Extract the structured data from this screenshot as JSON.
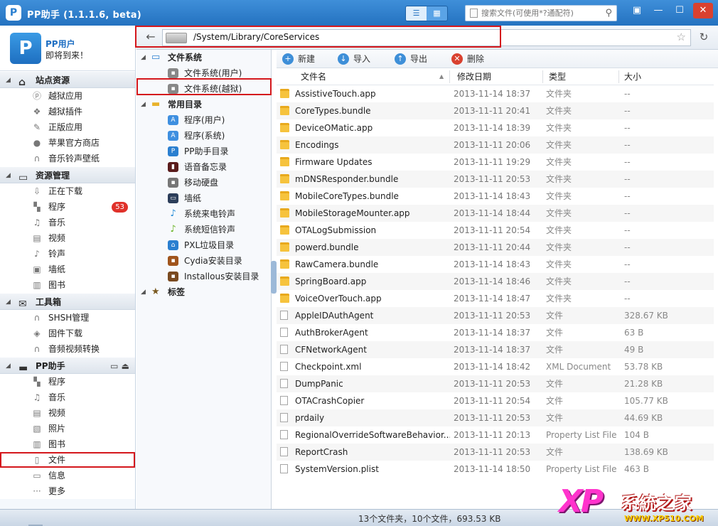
{
  "app": {
    "logo": "P",
    "title": "PP助手 (1.1.1.6, beta)"
  },
  "search": {
    "placeholder": "搜索文件(可使用*?通配符)"
  },
  "window_controls": {
    "menu": "▣",
    "minimize": "—",
    "maximize": "☐",
    "close": "✕"
  },
  "user": {
    "name": "PP用户",
    "status": "即将到来！"
  },
  "sections": {
    "site": {
      "title": "站点资源",
      "items": [
        {
          "label": "越狱应用",
          "icon": "p-circle-icon"
        },
        {
          "label": "越狱插件",
          "icon": "plugin-icon"
        },
        {
          "label": "正版应用",
          "icon": "app-store-icon"
        },
        {
          "label": "苹果官方商店",
          "icon": "apple-icon"
        },
        {
          "label": "音乐铃声壁纸",
          "icon": "headphones-icon"
        }
      ]
    },
    "resources": {
      "title": "资源管理",
      "items": [
        {
          "label": "正在下载",
          "icon": "download-icon"
        },
        {
          "label": "程序",
          "icon": "apps-grid-icon",
          "badge": "53"
        },
        {
          "label": "音乐",
          "icon": "music-icon"
        },
        {
          "label": "视频",
          "icon": "video-icon"
        },
        {
          "label": "铃声",
          "icon": "ringtone-icon"
        },
        {
          "label": "墙纸",
          "icon": "wallpaper-icon"
        },
        {
          "label": "图书",
          "icon": "book-icon"
        }
      ]
    },
    "tools": {
      "title": "工具箱",
      "items": [
        {
          "label": "SHSH管理",
          "icon": "shsh-icon"
        },
        {
          "label": "固件下载",
          "icon": "firmware-icon"
        },
        {
          "label": "音频视频转换",
          "icon": "convert-icon"
        }
      ]
    },
    "pp": {
      "title": "PP助手",
      "items": [
        {
          "label": "程序",
          "icon": "apps-grid-icon"
        },
        {
          "label": "音乐",
          "icon": "music-icon"
        },
        {
          "label": "视频",
          "icon": "video-icon"
        },
        {
          "label": "照片",
          "icon": "photo-icon"
        },
        {
          "label": "图书",
          "icon": "book-icon"
        },
        {
          "label": "文件",
          "icon": "file-icon"
        },
        {
          "label": "信息",
          "icon": "message-icon"
        },
        {
          "label": "更多",
          "icon": "more-icon"
        }
      ]
    }
  },
  "address": {
    "path": "/System/Library/CoreServices"
  },
  "tree": {
    "filesystem": {
      "title": "文件系统",
      "items": [
        "文件系统(用户)",
        "文件系统(越狱)"
      ]
    },
    "common": {
      "title": "常用目录",
      "items": [
        "程序(用户)",
        "程序(系统)",
        "PP助手目录",
        "语音备忘录",
        "移动硬盘",
        "墙纸",
        "系统来电铃声",
        "系统短信铃声",
        "PXL垃圾目录",
        "Cydia安装目录",
        "Installous安装目录"
      ]
    },
    "tags": {
      "title": "标签"
    }
  },
  "toolbar": {
    "new": "新建",
    "import": "导入",
    "export": "导出",
    "delete": "删除"
  },
  "columns": {
    "name": "文件名",
    "date": "修改日期",
    "type": "类型",
    "size": "大小"
  },
  "files": [
    {
      "kind": "folder",
      "name": "AssistiveTouch.app",
      "date": "2013-11-14 18:37",
      "type": "文件夹",
      "size": "--"
    },
    {
      "kind": "folder",
      "name": "CoreTypes.bundle",
      "date": "2013-11-11 20:41",
      "type": "文件夹",
      "size": "--"
    },
    {
      "kind": "folder",
      "name": "DeviceOMatic.app",
      "date": "2013-11-14 18:39",
      "type": "文件夹",
      "size": "--"
    },
    {
      "kind": "folder",
      "name": "Encodings",
      "date": "2013-11-11 20:06",
      "type": "文件夹",
      "size": "--"
    },
    {
      "kind": "folder",
      "name": "Firmware Updates",
      "date": "2013-11-11 19:29",
      "type": "文件夹",
      "size": "--"
    },
    {
      "kind": "folder",
      "name": "mDNSResponder.bundle",
      "date": "2013-11-11 20:53",
      "type": "文件夹",
      "size": "--"
    },
    {
      "kind": "folder",
      "name": "MobileCoreTypes.bundle",
      "date": "2013-11-14 18:43",
      "type": "文件夹",
      "size": "--"
    },
    {
      "kind": "folder",
      "name": "MobileStorageMounter.app",
      "date": "2013-11-14 18:44",
      "type": "文件夹",
      "size": "--"
    },
    {
      "kind": "folder",
      "name": "OTALogSubmission",
      "date": "2013-11-11 20:54",
      "type": "文件夹",
      "size": "--"
    },
    {
      "kind": "folder",
      "name": "powerd.bundle",
      "date": "2013-11-11 20:44",
      "type": "文件夹",
      "size": "--"
    },
    {
      "kind": "folder",
      "name": "RawCamera.bundle",
      "date": "2013-11-14 18:43",
      "type": "文件夹",
      "size": "--"
    },
    {
      "kind": "folder",
      "name": "SpringBoard.app",
      "date": "2013-11-14 18:46",
      "type": "文件夹",
      "size": "--"
    },
    {
      "kind": "folder",
      "name": "VoiceOverTouch.app",
      "date": "2013-11-14 18:47",
      "type": "文件夹",
      "size": "--"
    },
    {
      "kind": "file",
      "name": "AppleIDAuthAgent",
      "date": "2013-11-11 20:53",
      "type": "文件",
      "size": "328.67 KB"
    },
    {
      "kind": "file",
      "name": "AuthBrokerAgent",
      "date": "2013-11-14 18:37",
      "type": "文件",
      "size": "63 B"
    },
    {
      "kind": "file",
      "name": "CFNetworkAgent",
      "date": "2013-11-14 18:37",
      "type": "文件",
      "size": "49 B"
    },
    {
      "kind": "file",
      "name": "Checkpoint.xml",
      "date": "2013-11-14 18:42",
      "type": "XML Document",
      "size": "53.78 KB"
    },
    {
      "kind": "file",
      "name": "DumpPanic",
      "date": "2013-11-11 20:53",
      "type": "文件",
      "size": "21.28 KB"
    },
    {
      "kind": "file",
      "name": "OTACrashCopier",
      "date": "2013-11-11 20:54",
      "type": "文件",
      "size": "105.77 KB"
    },
    {
      "kind": "file",
      "name": "prdaily",
      "date": "2013-11-11 20:53",
      "type": "文件",
      "size": "44.69 KB"
    },
    {
      "kind": "file",
      "name": "RegionalOverrideSoftwareBehavior...",
      "date": "2013-11-11 20:13",
      "type": "Property List File",
      "size": "104 B"
    },
    {
      "kind": "file",
      "name": "ReportCrash",
      "date": "2013-11-11 20:53",
      "type": "文件",
      "size": "138.69 KB"
    },
    {
      "kind": "file",
      "name": "SystemVersion.plist",
      "date": "2013-11-14 18:50",
      "type": "Property List File",
      "size": "463 B"
    }
  ],
  "status": {
    "summary": "13个文件夹，10个文件，693.53 KB"
  },
  "watermark": {
    "brand": "XP",
    "title": "系統之家",
    "url": "WWW.XP510.COM"
  },
  "colors": {
    "titlebar": "#2a7fd0",
    "highlight": "#d4171c",
    "badge": "#e0312a",
    "folder": "#f6c33d"
  }
}
